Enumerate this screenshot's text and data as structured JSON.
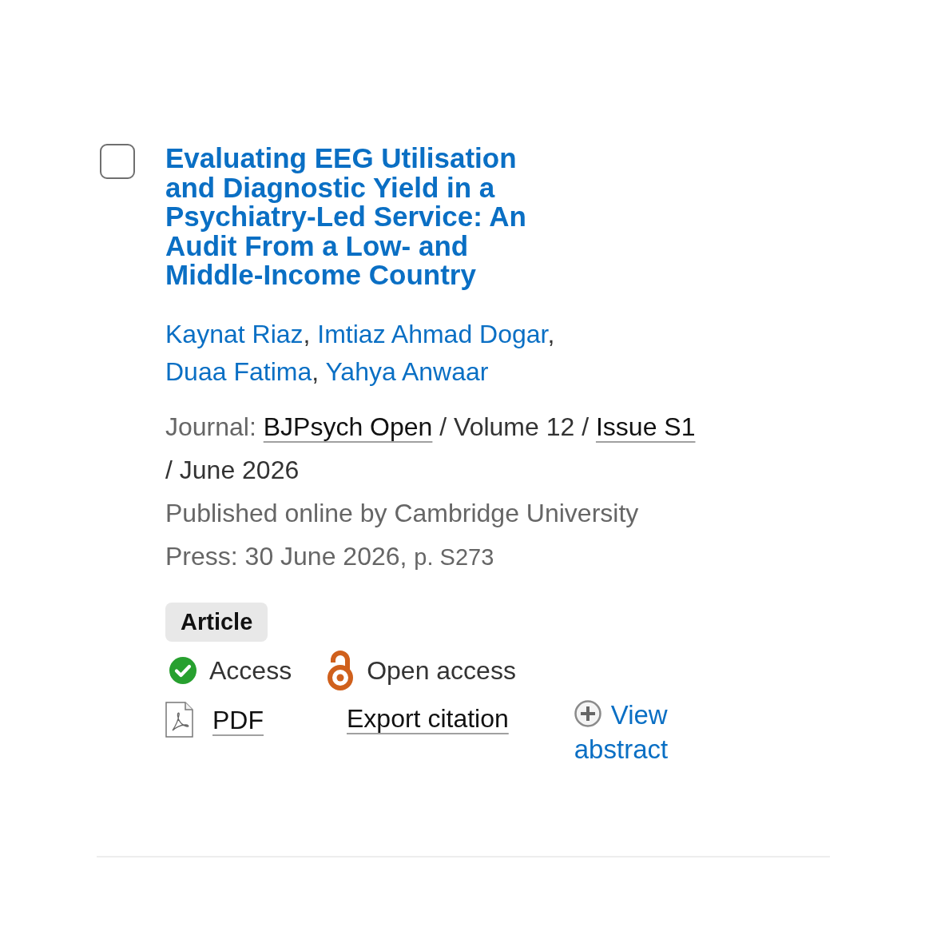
{
  "result": {
    "checked": false,
    "title": "Evaluating EEG Utilisation and Diagnostic Yield in a Psychiatry-Led Service: An Audit From a Low- and Middle-Income Country",
    "authors": {
      "names": [
        "Kaynat Riaz",
        "Imtiaz Ahmad Dogar",
        "Duaa Fatima",
        "Yahya Anwaar"
      ],
      "separator": ","
    },
    "journal_line": [
      {
        "kind": "label",
        "text": "Journal:"
      },
      {
        "kind": "link",
        "text": "BJPsych Open"
      },
      {
        "kind": "plain",
        "text": "/"
      },
      {
        "kind": "plain",
        "text": "Volume 12"
      },
      {
        "kind": "plain",
        "text": "/"
      },
      {
        "kind": "link",
        "text": "Issue S1"
      },
      {
        "kind": "plain",
        "text": "/"
      },
      {
        "kind": "plain",
        "text": "June 2026"
      }
    ],
    "published": "Published online by Cambridge University Press: 30 June 2026,",
    "pages": "p. S273",
    "type_tag": "Article",
    "access": [
      {
        "kind": "access",
        "label": "Access"
      },
      {
        "kind": "open_access",
        "label": "Open access"
      }
    ],
    "actions": [
      {
        "kind": "pdf",
        "label": "PDF"
      },
      {
        "kind": "export",
        "label": "Export citation"
      },
      {
        "kind": "abstract",
        "label": "View abstract"
      }
    ]
  }
}
